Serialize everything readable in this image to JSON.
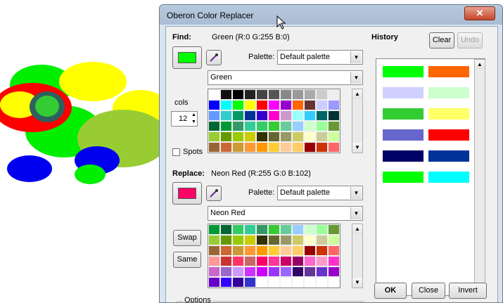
{
  "window": {
    "title": "Oberon Color Replacer",
    "close_label": "✕"
  },
  "find": {
    "label": "Find:",
    "color_desc": "Green (R:0 G:255 B:0)",
    "swatch": "#00ff00",
    "palette_label": "Palette:",
    "palette_value": "Default palette",
    "name_value": "Green"
  },
  "cols": {
    "label": "cols",
    "value": "12"
  },
  "spots": {
    "label": "Spots"
  },
  "replace": {
    "label": "Replace:",
    "color_desc": "Neon Red (R:255 G:0 B:102)",
    "swatch": "#ff0066",
    "palette_label": "Palette:",
    "palette_value": "Default palette",
    "name_value": "Neon Red"
  },
  "buttons": {
    "swap": "Swap",
    "same": "Same",
    "clear": "Clear",
    "undo": "Undo",
    "ok": "OK",
    "close": "Close",
    "invert": "Invert"
  },
  "options": {
    "label": "Options"
  },
  "history": {
    "label": "History",
    "pairs": [
      {
        "find": "#00ff00",
        "replace": "#ff6600"
      },
      {
        "find": "#d0d0ff",
        "replace": "#ccffcc"
      },
      {
        "find": "#33cc33",
        "replace": "#ffff66"
      },
      {
        "find": "#6666cc",
        "replace": "#ff0000"
      },
      {
        "find": "#000066",
        "replace": "#003399"
      },
      {
        "find": "#00ff00",
        "replace": "#00ffff"
      }
    ]
  },
  "find_palette": [
    "#ffffff",
    "#111111",
    "#000000",
    "#222222",
    "#444444",
    "#555555",
    "#888888",
    "#999999",
    "#aaaaaa",
    "#cccccc",
    "#eeeeee",
    "#0000ff",
    "#00ffff",
    "#00ff00",
    "#ffff00",
    "#ff0000",
    "#ff00ff",
    "#9900cc",
    "#ff6600",
    "#663333",
    "#ccccff",
    "#9999ff",
    "#6699ff",
    "#33cccc",
    "#009966",
    "#003399",
    "#3300cc",
    "#ff00cc",
    "#cc99cc",
    "#99ffff",
    "#33ccff",
    "#006666",
    "#003333",
    "#006633",
    "#009933",
    "#339966",
    "#33cc99",
    "#33cc66",
    "#33cc33",
    "#66cc99",
    "#99ccff",
    "#ccffcc",
    "#99ff99",
    "#669933",
    "#99cc33",
    "#669900",
    "#99cc00",
    "#cccc00",
    "#333300",
    "#666633",
    "#999966",
    "#cccc66",
    "#ffffcc",
    "#cccc99",
    "#ccff99",
    "#996633",
    "#cc6633",
    "#cc9933",
    "#ff9933",
    "#ff9900",
    "#ffcc33",
    "#ffcc99",
    "#ffcc66",
    "#990000",
    "#cc3300",
    "#ff6666"
  ],
  "replace_palette": [
    "#009933",
    "#006633",
    "#33cc66",
    "#33cc99",
    "#339966",
    "#33cc33",
    "#66cc99",
    "#99ccff",
    "#ccffcc",
    "#99ff99",
    "#669933",
    "#99cc33",
    "#669900",
    "#99cc00",
    "#cccc00",
    "#333300",
    "#666633",
    "#999966",
    "#cccc66",
    "#ffffcc",
    "#cccc99",
    "#ccff99",
    "#996633",
    "#cc6633",
    "#cc9933",
    "#ff9933",
    "#ff9900",
    "#ffcc33",
    "#ffcc99",
    "#ffcc66",
    "#990000",
    "#cc3300",
    "#ff6666",
    "#ff9999",
    "#cc3333",
    "#ff3366",
    "#cc6666",
    "#ff0066",
    "#ff3399",
    "#cc0066",
    "#990066",
    "#ff66cc",
    "#ff99cc",
    "#ff33cc",
    "#cc66cc",
    "#9966cc",
    "#cc99ff",
    "#cc33ff",
    "#cc00ff",
    "#9933ff",
    "#9966ff",
    "#330066",
    "#663399",
    "#6633cc",
    "#9900cc",
    "#6600cc",
    "#3300ff",
    "#330099",
    "#3333cc",
    "#ffffff",
    "#ffffff",
    "#ffffff",
    "#ffffff",
    "#ffffff",
    "#ffffff",
    "#ffffff"
  ],
  "colors": {
    "win_frame": "#a9bcd3",
    "client_bg": "#f0f0f0"
  }
}
